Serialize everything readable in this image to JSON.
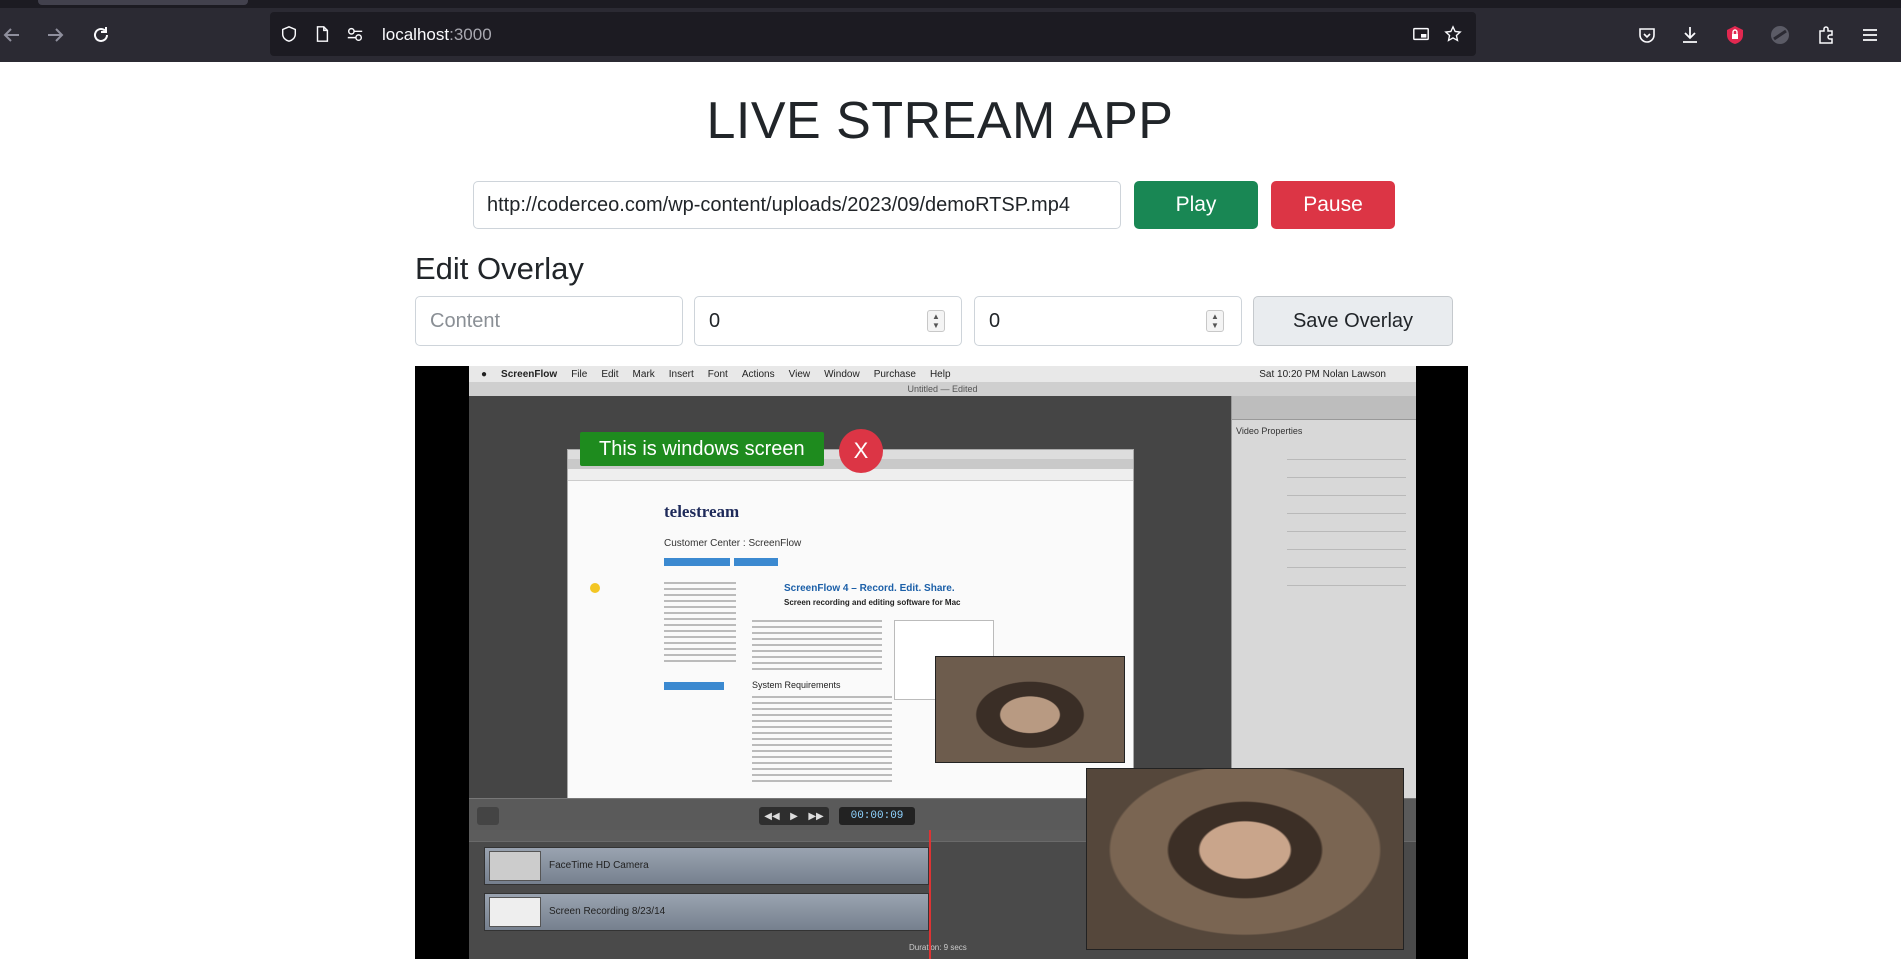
{
  "browser": {
    "url_host": "localhost",
    "url_port": ":3000"
  },
  "app": {
    "title": "LIVE STREAM APP"
  },
  "stream": {
    "url_value": "http://coderceo.com/wp-content/uploads/2023/09/demoRTSP.mp4",
    "play_label": "Play",
    "pause_label": "Pause"
  },
  "overlay_editor": {
    "heading": "Edit Overlay",
    "content_placeholder": "Content",
    "x_value": "0",
    "y_value": "0",
    "save_label": "Save Overlay"
  },
  "video": {
    "mac_menu": [
      "ScreenFlow",
      "File",
      "Edit",
      "Mark",
      "Insert",
      "Font",
      "Actions",
      "View",
      "Window",
      "Purchase",
      "Help"
    ],
    "mac_clock": "Sat 10:20 PM   Nolan Lawson",
    "window_title": "Untitled — Edited",
    "site_logo": "telestream",
    "site_heading": "Customer Center : ScreenFlow",
    "site_product": "ScreenFlow 4 – Record. Edit. Share.",
    "site_tagline": "Screen recording and editing software for Mac",
    "site_section": "System Requirements",
    "props_title": "Video Properties",
    "timecode": "00:00:09",
    "track_1": "FaceTime HD Camera",
    "track_2": "Screen Recording 8/23/14",
    "duration": "Duration: 9 secs"
  },
  "overlay": {
    "text": "This is windows screen",
    "close_label": "X"
  },
  "colors": {
    "play": "#198754",
    "pause": "#dc3545",
    "overlay_bg": "#1e8b1e"
  }
}
